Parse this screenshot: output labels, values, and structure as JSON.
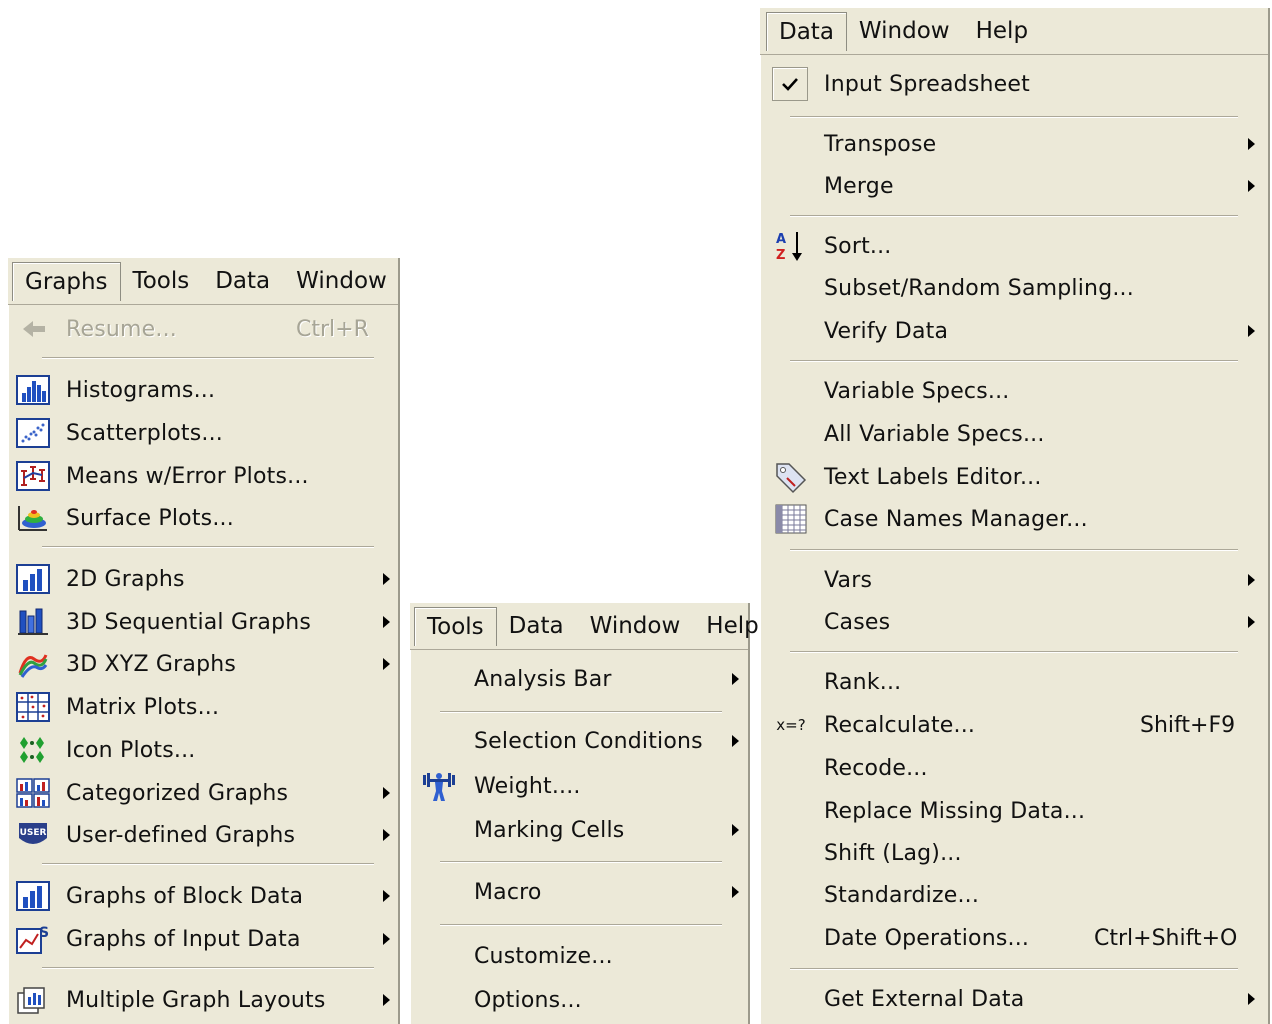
{
  "graphs_panel": {
    "menubar": [
      "Graphs",
      "Tools",
      "Data",
      "Window"
    ],
    "items": [
      {
        "label": "Resume...",
        "shortcut": "Ctrl+R",
        "disabled": true,
        "icon": "resume-arrow-icon"
      },
      {
        "label": "Histograms...",
        "icon": "histogram-icon"
      },
      {
        "label": "Scatterplots...",
        "icon": "scatterplot-icon"
      },
      {
        "label": "Means w/Error Plots...",
        "icon": "means-error-plot-icon"
      },
      {
        "label": "Surface Plots...",
        "icon": "surface-plot-icon"
      },
      {
        "label": "2D Graphs",
        "icon": "2d-graph-icon",
        "submenu": true
      },
      {
        "label": "3D Sequential Graphs",
        "icon": "3d-sequential-graph-icon",
        "submenu": true
      },
      {
        "label": "3D XYZ Graphs",
        "icon": "3d-xyz-graph-icon",
        "submenu": true
      },
      {
        "label": "Matrix Plots...",
        "icon": "matrix-plot-icon"
      },
      {
        "label": "Icon Plots...",
        "icon": "icon-plot-icon"
      },
      {
        "label": "Categorized Graphs",
        "icon": "categorized-graph-icon",
        "submenu": true
      },
      {
        "label": "User-defined Graphs",
        "icon": "user-defined-graph-icon",
        "submenu": true
      },
      {
        "label": "Graphs of Block Data",
        "icon": "block-data-graph-icon",
        "submenu": true
      },
      {
        "label": "Graphs of Input Data",
        "icon": "input-data-graph-icon",
        "submenu": true
      },
      {
        "label": "Multiple Graph Layouts",
        "icon": "multiple-graph-layout-icon",
        "submenu": true
      }
    ]
  },
  "tools_panel": {
    "menubar": [
      "Tools",
      "Data",
      "Window",
      "Help"
    ],
    "items": [
      {
        "label": "Analysis Bar",
        "submenu": true
      },
      {
        "label": "Selection Conditions",
        "submenu": true
      },
      {
        "label": "Weight....",
        "icon": "weight-icon"
      },
      {
        "label": "Marking Cells",
        "submenu": true
      },
      {
        "label": "Macro",
        "submenu": true
      },
      {
        "label": "Customize..."
      },
      {
        "label": "Options..."
      }
    ]
  },
  "data_panel": {
    "menubar": [
      "Data",
      "Window",
      "Help"
    ],
    "items": [
      {
        "label": "Input Spreadsheet",
        "icon": "check-icon",
        "checked": true
      },
      {
        "label": "Transpose",
        "submenu": true
      },
      {
        "label": "Merge",
        "submenu": true
      },
      {
        "label": "Sort...",
        "icon": "sort-az-icon"
      },
      {
        "label": "Subset/Random Sampling..."
      },
      {
        "label": "Verify Data",
        "submenu": true
      },
      {
        "label": "Variable Specs..."
      },
      {
        "label": "All Variable Specs..."
      },
      {
        "label": "Text Labels Editor...",
        "icon": "tag-icon"
      },
      {
        "label": "Case Names Manager...",
        "icon": "case-names-grid-icon"
      },
      {
        "label": "Vars",
        "submenu": true
      },
      {
        "label": "Cases",
        "submenu": true
      },
      {
        "label": "Rank..."
      },
      {
        "label": "Recalculate...",
        "shortcut": "Shift+F9",
        "icon_text": "x=?"
      },
      {
        "label": "Recode..."
      },
      {
        "label": "Replace Missing Data..."
      },
      {
        "label": "Shift (Lag)..."
      },
      {
        "label": "Standardize..."
      },
      {
        "label": "Date Operations...",
        "shortcut": "Ctrl+Shift+O"
      },
      {
        "label": "Get External Data",
        "submenu": true
      }
    ]
  }
}
